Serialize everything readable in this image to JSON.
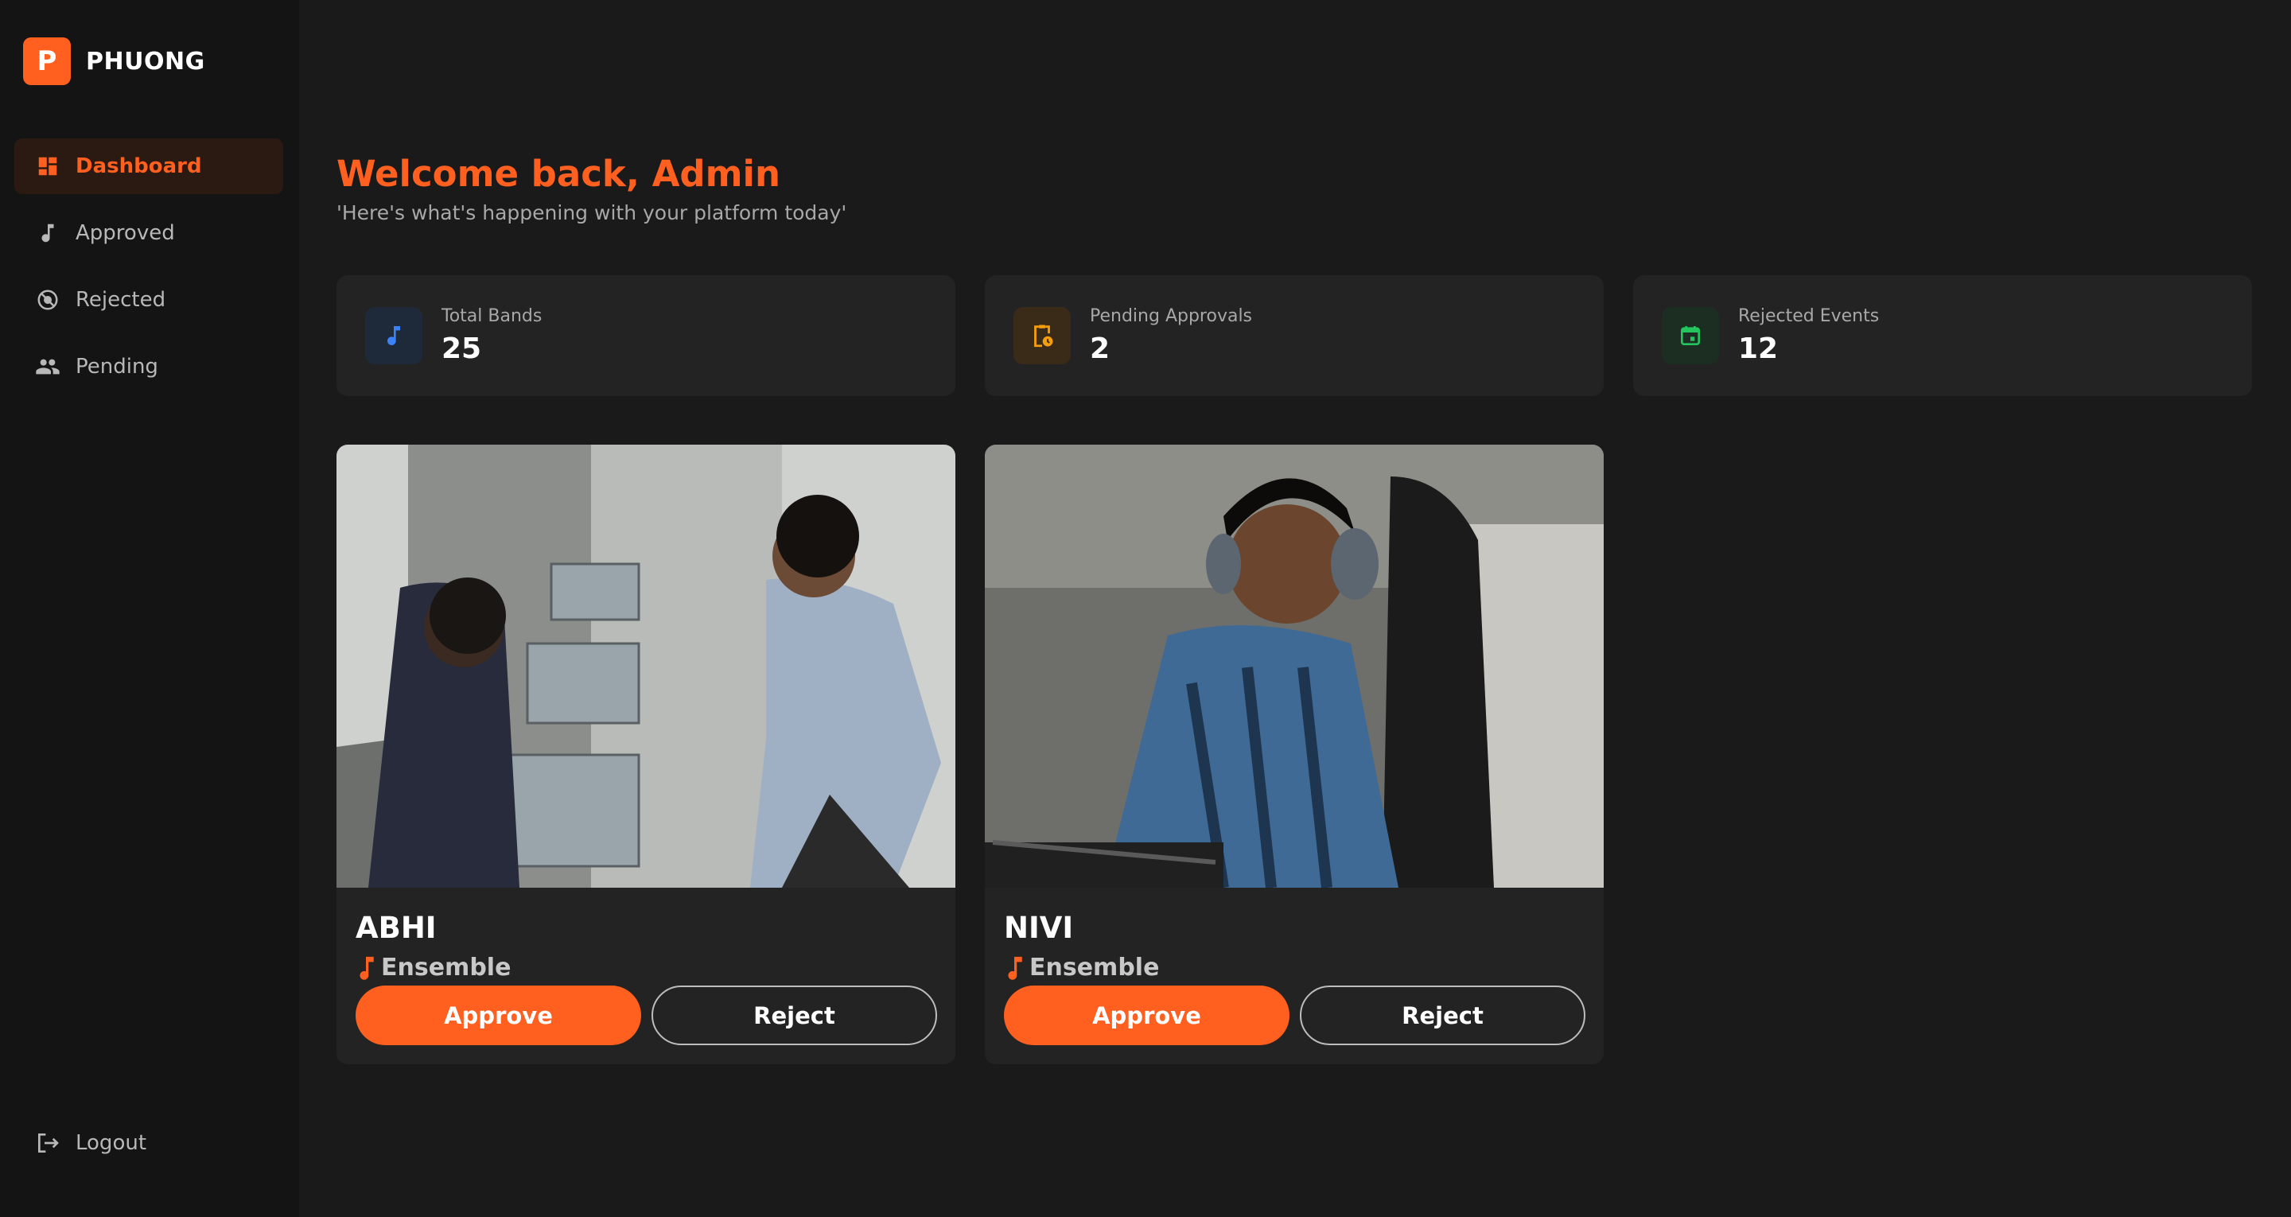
{
  "brand": {
    "initial": "P",
    "name": "PHUONG",
    "accent": "#ff5f1f"
  },
  "sidebar": {
    "items": [
      {
        "label": "Dashboard",
        "icon": "dashboard-icon",
        "active": true
      },
      {
        "label": "Approved",
        "icon": "music-note-icon",
        "active": false
      },
      {
        "label": "Rejected",
        "icon": "block-icon",
        "active": false
      },
      {
        "label": "Pending",
        "icon": "people-icon",
        "active": false
      }
    ],
    "logout_label": "Logout"
  },
  "header": {
    "title": "Welcome back, Admin",
    "subtitle": "'Here's what's happening with your platform today'"
  },
  "stats": [
    {
      "label": "Total Bands",
      "value": "25",
      "icon": "music-note-icon",
      "color": "#3b82f6"
    },
    {
      "label": "Pending Approvals",
      "value": "2",
      "icon": "clipboard-clock-icon",
      "color": "#f59e0b"
    },
    {
      "label": "Rejected Events",
      "value": "12",
      "icon": "calendar-icon",
      "color": "#22c55e"
    }
  ],
  "cards": [
    {
      "name": "ABHI",
      "genre": "Ensemble",
      "approve_label": "Approve",
      "reject_label": "Reject"
    },
    {
      "name": "NIVI",
      "genre": "Ensemble",
      "approve_label": "Approve",
      "reject_label": "Reject"
    }
  ]
}
